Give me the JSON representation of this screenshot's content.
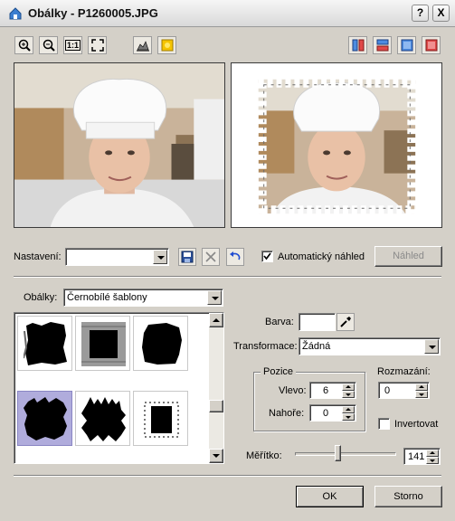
{
  "window": {
    "title": "Obálky - P1260005.JPG",
    "help_label": "?",
    "close_label": "X"
  },
  "toolbar": {
    "zoom_fit_label": "1:1"
  },
  "settings": {
    "label": "Nastavení:",
    "value": "",
    "auto_preview_label": "Automatický náhled",
    "auto_preview_checked": true,
    "preview_button": "Náhled"
  },
  "envelopes": {
    "label": "Obálky:",
    "value": "Černobílé šablony"
  },
  "color": {
    "label": "Barva:"
  },
  "transform": {
    "label": "Transformace:",
    "value": "Žádná"
  },
  "position": {
    "group_label": "Pozice",
    "left_label": "Vlevo:",
    "left_value": "6",
    "top_label": "Nahoře:",
    "top_value": "0"
  },
  "blur": {
    "label": "Rozmazání:",
    "value": "0"
  },
  "invert": {
    "label": "Invertovat",
    "checked": false
  },
  "scale": {
    "label": "Měřítko:",
    "value": "141"
  },
  "buttons": {
    "ok": "OK",
    "cancel": "Storno"
  },
  "colors": {
    "selection": "#b0acdc",
    "accent": "#1f4bd1"
  }
}
